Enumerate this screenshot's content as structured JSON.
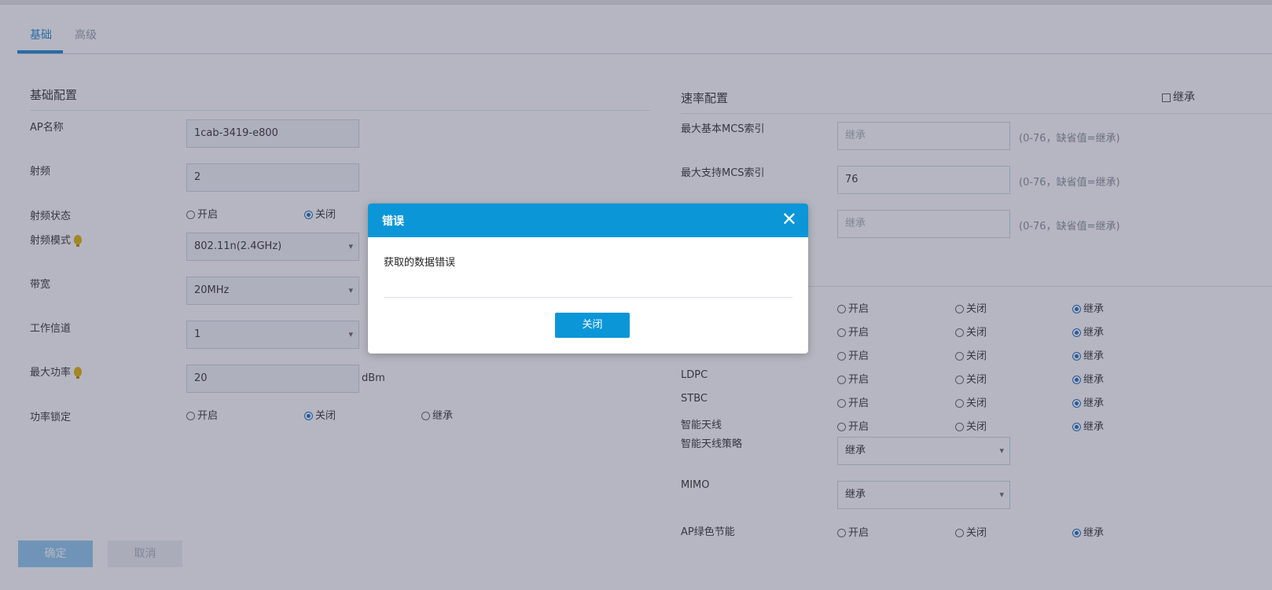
{
  "tabs": [
    {
      "label": "基础",
      "active": true
    },
    {
      "label": "高级",
      "active": false
    }
  ],
  "basic": {
    "title": "基础配置",
    "ap_name": {
      "label": "AP名称",
      "value": "1cab-3419-e800"
    },
    "radio": {
      "label": "射频",
      "value": "2"
    },
    "radio_state": {
      "label": "射频状态",
      "options": [
        "开启",
        "关闭"
      ],
      "selected": "关闭"
    },
    "radio_mode": {
      "label": "射频模式",
      "value": "802.11n(2.4GHz)"
    },
    "bandwidth": {
      "label": "带宽",
      "value": "20MHz"
    },
    "channel": {
      "label": "工作信道",
      "value": "1"
    },
    "max_power": {
      "label": "最大功率",
      "value": "20",
      "unit": "dBm"
    },
    "power_lock": {
      "label": "功率锁定",
      "options": [
        "开启",
        "关闭",
        "继承"
      ],
      "selected": "关闭"
    }
  },
  "rate": {
    "title": "速率配置",
    "inherit_label": "继承",
    "inherit_checked": false,
    "max_basic_mcs": {
      "label": "最大基本MCS索引",
      "placeholder": "继承",
      "hint": "(0-76，缺省值=继承)"
    },
    "max_support_mcs": {
      "label": "最大支持MCS索引",
      "value": "76",
      "hint": "(0-76，缺省值=继承)"
    },
    "third_field": {
      "placeholder": "继承",
      "hint": "(0-76，缺省值=继承)"
    },
    "radio_rows": [
      {
        "label": "",
        "selected": "继承"
      },
      {
        "label": "",
        "selected": "继承"
      },
      {
        "label": "",
        "selected": "继承"
      },
      {
        "label": "LDPC",
        "selected": "继承"
      },
      {
        "label": "STBC",
        "selected": "继承"
      },
      {
        "label": "智能天线",
        "selected": "继承"
      }
    ],
    "opt_on": "开启",
    "opt_off": "关闭",
    "opt_inherit": "继承",
    "smart_antenna_policy": {
      "label": "智能天线策略",
      "value": "继承"
    },
    "mimo": {
      "label": "MIMO",
      "value": "继承"
    },
    "ap_green": {
      "label": "AP绿色节能",
      "selected": "继承"
    }
  },
  "footer": {
    "confirm": "确定",
    "cancel": "取消"
  },
  "modal": {
    "title": "错误",
    "close_icon": "close-icon",
    "message": "获取的数据错误",
    "button": "关闭",
    "header_color": "#0b96d8"
  },
  "colors": {
    "accent": "#1b88d4",
    "bulb": "#e6b400"
  }
}
